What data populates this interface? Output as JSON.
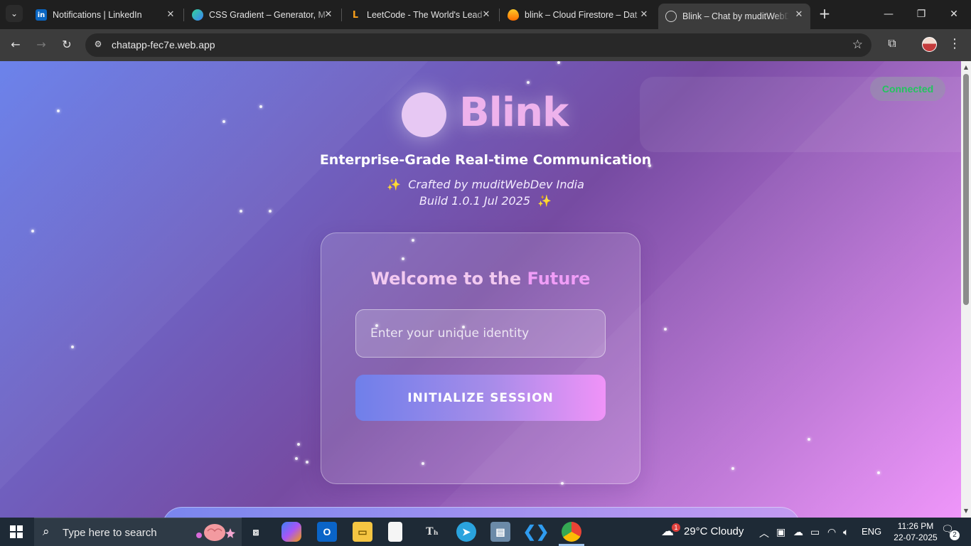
{
  "browser": {
    "tabs": [
      {
        "title": "Notifications | LinkedIn",
        "icon": "linkedin-icon",
        "color": "#0a66c2"
      },
      {
        "title": "CSS Gradient – Generator, M",
        "icon": "css-gradient-icon",
        "color": "#34d399"
      },
      {
        "title": "LeetCode - The World's Lead",
        "icon": "leetcode-icon",
        "color": "#f89f1b"
      },
      {
        "title": "blink – Cloud Firestore – Dat",
        "icon": "firebase-icon",
        "color": "#ff6d00"
      },
      {
        "title": "Blink – Chat by muditWebDe",
        "icon": "globe-icon",
        "color": "#e3e3e3",
        "active": true
      }
    ],
    "url": "chatapp-fec7e.web.app"
  },
  "page": {
    "status": "Connected",
    "brand": "Blink",
    "tagline": "Enterprise-Grade Real-time Communication",
    "credit_line1": "Crafted by muditWebDev India",
    "credit_line2": "Build 1.0.1 Jul 2025",
    "card": {
      "title_part1": "Welcome to the ",
      "title_part2": "Future",
      "input_placeholder": "Enter your unique identity",
      "button_label": "INITIALIZE SESSION"
    },
    "colors": {
      "gradient_start": "#667eea",
      "gradient_mid": "#764ba2",
      "gradient_end": "#f093fb",
      "status_green": "#22c55e",
      "brand_pink": "#eeb2ec"
    }
  },
  "taskbar": {
    "search_placeholder": "Type here to search",
    "weather": "29°C  Cloudy",
    "weather_badge": "1",
    "language": "ENG",
    "time": "11:26 PM",
    "date": "22-07-2025",
    "notification_count": "2"
  }
}
